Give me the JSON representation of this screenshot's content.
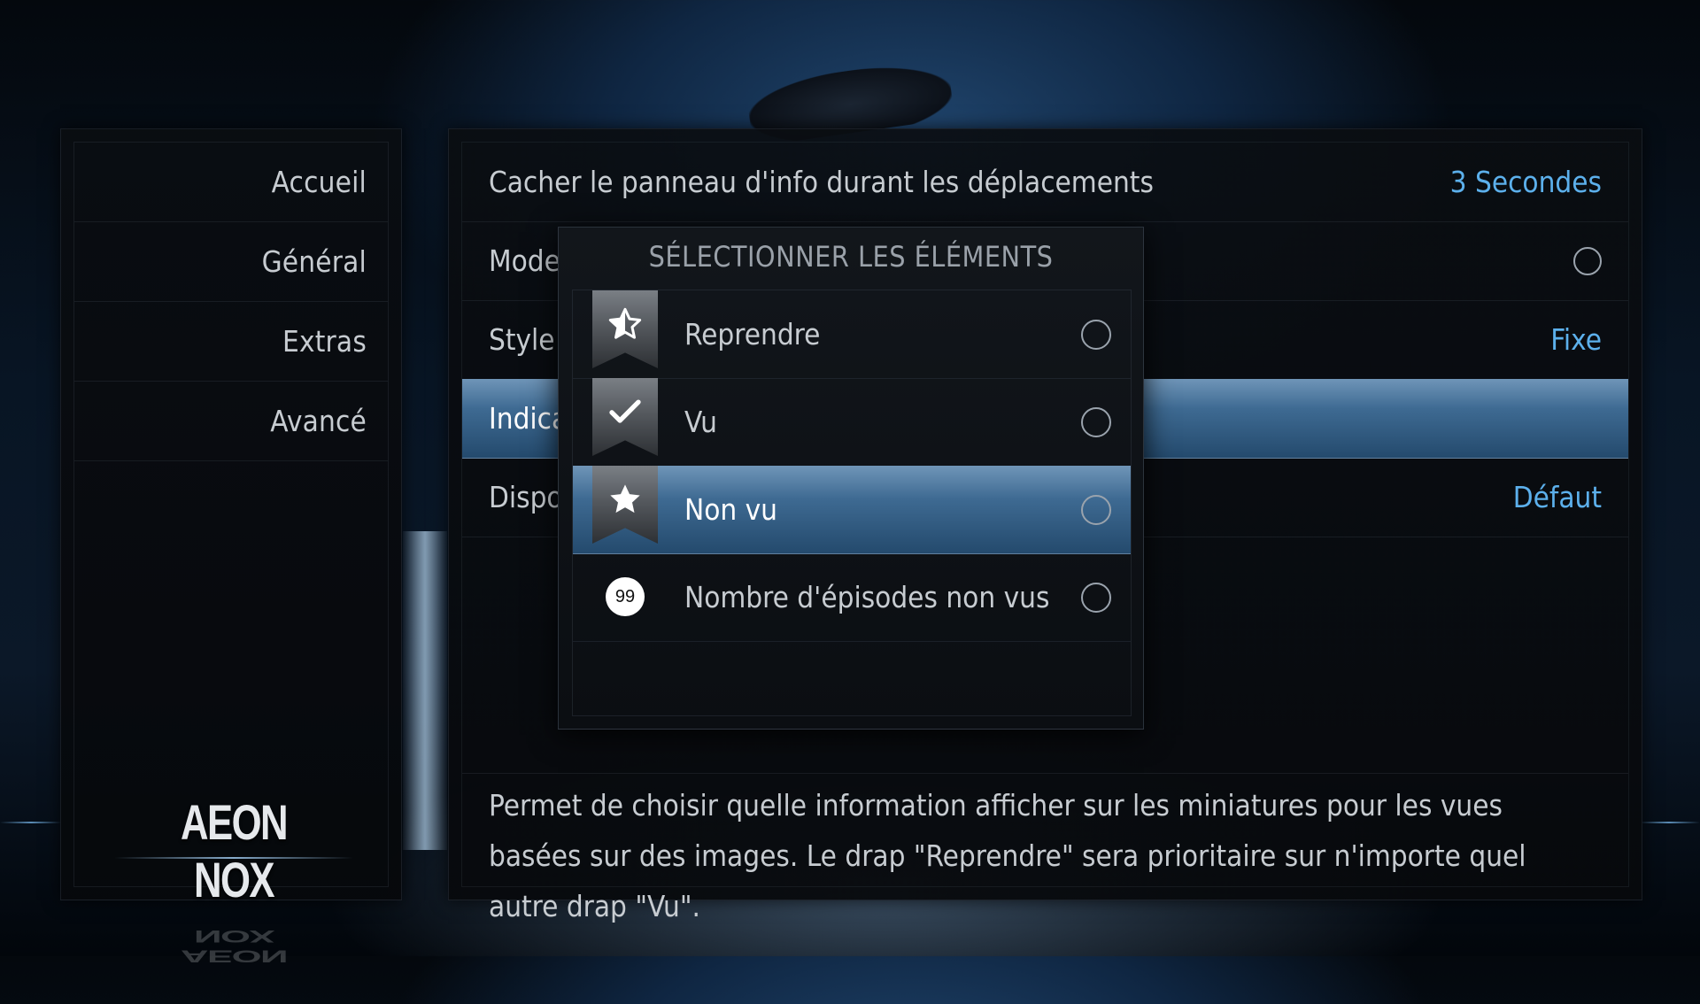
{
  "sidebar": {
    "items": [
      {
        "label": "Accueil"
      },
      {
        "label": "Général"
      },
      {
        "label": "Extras"
      },
      {
        "label": "Avancé"
      }
    ],
    "logo": "AEON NOX"
  },
  "settings": {
    "rows": [
      {
        "label": "Cacher le panneau d'info durant les déplacements",
        "value": "3 Secondes"
      },
      {
        "label": "Mode",
        "value": ""
      },
      {
        "label": "Style",
        "value": "Fixe"
      },
      {
        "label": "Indica",
        "value": ""
      },
      {
        "label": "Dispo",
        "value": "Défaut"
      }
    ],
    "description": "Permet de choisir quelle information afficher sur les miniatures pour les vues basées sur des images. Le drap \"Reprendre\" sera prioritaire sur n'importe quel autre drap \"Vu\"."
  },
  "dialog": {
    "title": "SÉLECTIONNER LES ÉLÉMENTS",
    "items": [
      {
        "label": "Reprendre",
        "icon": "half-star-bookmark-icon"
      },
      {
        "label": "Vu",
        "icon": "checkmark-bookmark-icon"
      },
      {
        "label": "Non vu",
        "icon": "star-bookmark-icon"
      },
      {
        "label": "Nombre d'épisodes non vus",
        "icon": "episode-count-badge-icon",
        "badge": "99"
      }
    ],
    "focused_index": 2
  },
  "colors": {
    "accent_value": "#5cb0ec",
    "selection_top": "#6f95b8",
    "selection_bottom": "#244a6d"
  }
}
